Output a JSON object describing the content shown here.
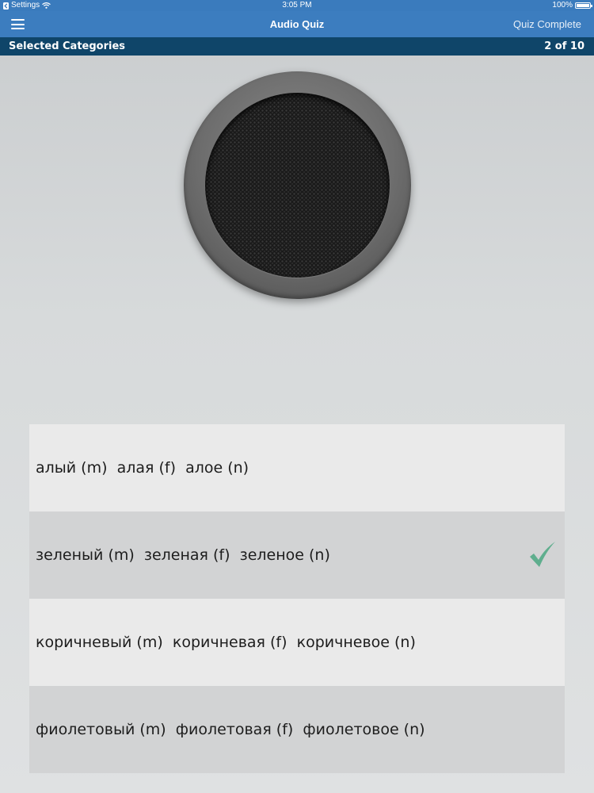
{
  "status_bar": {
    "back_app": "Settings",
    "time": "3:05 PM",
    "battery_text": "100%",
    "battery_level": 1.0,
    "icons": [
      "back-arrow-icon",
      "wifi-icon",
      "battery-icon"
    ]
  },
  "nav": {
    "menu_icon": "hamburger-menu-icon",
    "title": "Audio Quiz",
    "right_action": "Quiz Complete"
  },
  "category_bar": {
    "title": "Selected Categories",
    "progress": "2 of 10"
  },
  "speaker": {
    "icon": "speaker-icon"
  },
  "answers": [
    {
      "label": "алый (m)  алая (f)  алое (n)",
      "correct": false
    },
    {
      "label": "зеленый (m)  зеленая (f)  зеленое (n)",
      "correct": true
    },
    {
      "label": "коричневый (m)  коричневая (f)  коричневое (n)",
      "correct": false
    },
    {
      "label": "фиолетовый (m)  фиолетовая (f)  фиолетовое (n)",
      "correct": false
    }
  ],
  "colors": {
    "status_bar": "#3a7bbd",
    "nav_bar": "#3c7dbf",
    "category_bar": "#0f4569",
    "check_mark": "#5fae8e",
    "answer_light": "#eaeaea",
    "answer_dark": "#d2d3d4"
  }
}
